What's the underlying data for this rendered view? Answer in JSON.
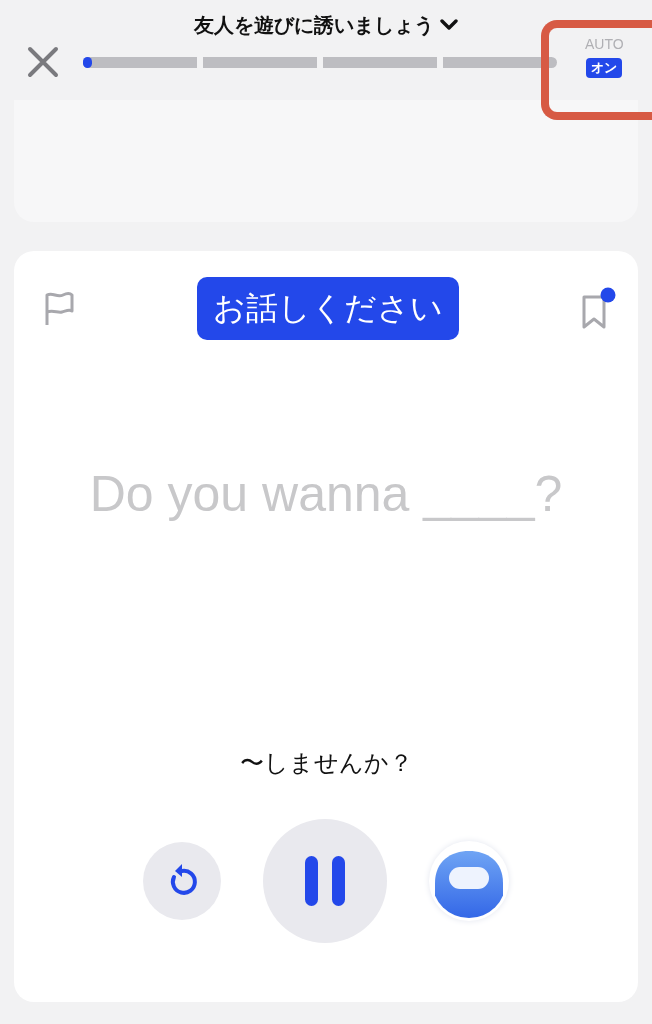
{
  "header": {
    "title": "友人を遊びに誘いましょう",
    "progress": {
      "level": 0.02
    },
    "auto": {
      "label": "AUTO",
      "badge": "オン",
      "on": true
    },
    "highlighted": true
  },
  "card": {
    "prompt": "お話しください",
    "bookmark_badge": true,
    "sentence": "Do you wanna ____?",
    "translation": "〜しませんか？"
  },
  "controls": {
    "playing": true
  }
}
